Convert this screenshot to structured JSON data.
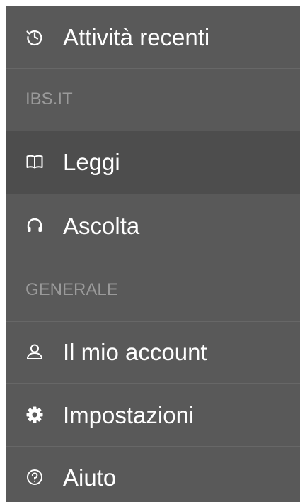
{
  "menu": {
    "recent": {
      "label": "Attività recenti",
      "icon": "history-icon"
    },
    "section_ibs": "IBS.IT",
    "read": {
      "label": "Leggi",
      "icon": "book-icon",
      "selected": true
    },
    "listen": {
      "label": "Ascolta",
      "icon": "headphones-icon"
    },
    "section_general": "GENERALE",
    "account": {
      "label": "Il mio account",
      "icon": "user-icon"
    },
    "settings": {
      "label": "Impostazioni",
      "icon": "gear-icon"
    },
    "help": {
      "label": "Aiuto",
      "icon": "help-icon"
    }
  },
  "colors": {
    "background": "#595959",
    "selected_background": "#4d4d4d",
    "text": "#ffffff",
    "section_text": "#9a9a9a"
  }
}
